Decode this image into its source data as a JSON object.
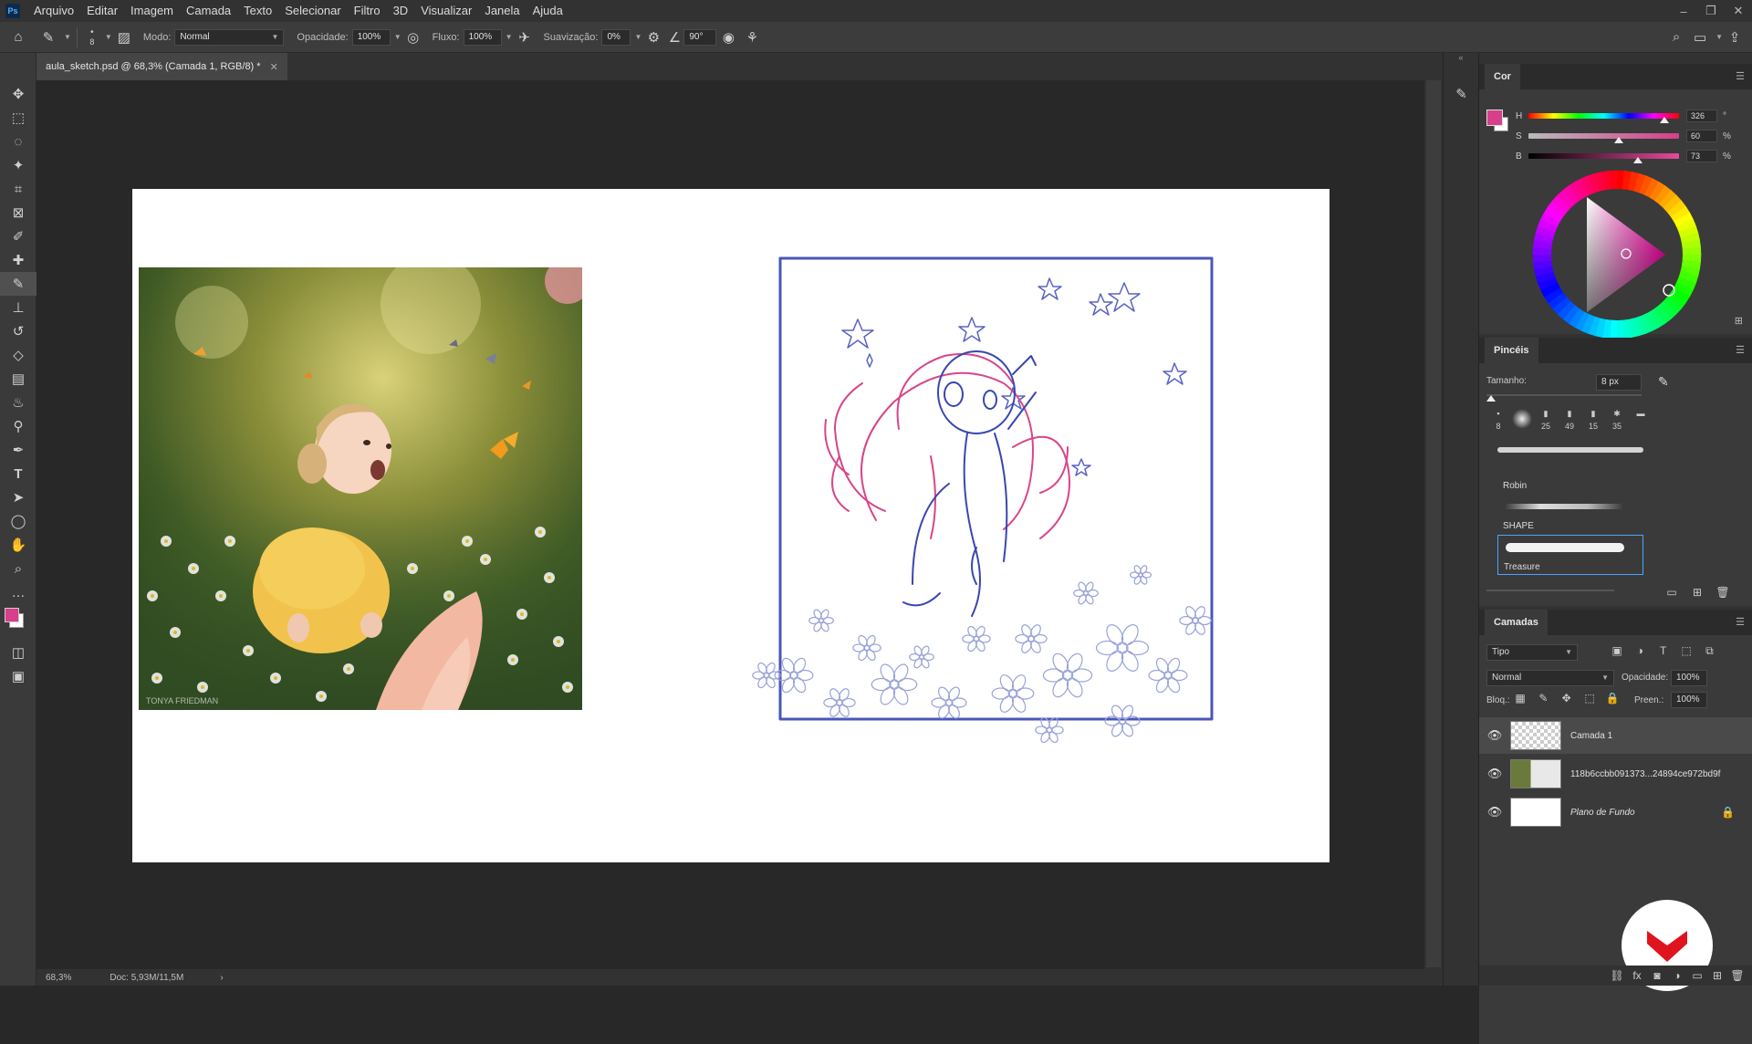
{
  "app": {
    "logo": "Ps"
  },
  "menu": [
    "Arquivo",
    "Editar",
    "Imagem",
    "Camada",
    "Texto",
    "Selecionar",
    "Filtro",
    "3D",
    "Visualizar",
    "Janela",
    "Ajuda"
  ],
  "window_controls": {
    "minimize": "–",
    "restore": "❐",
    "close": "✕"
  },
  "options": {
    "brush_size": "8",
    "mode_label": "Modo:",
    "mode_value": "Normal",
    "opacity_label": "Opacidade:",
    "opacity_value": "100%",
    "flow_label": "Fluxo:",
    "flow_value": "100%",
    "smoothing_label": "Suavização:",
    "smoothing_value": "0%",
    "angle_value": "90°"
  },
  "document": {
    "tab_title": "aula_sketch.psd @ 68,3% (Camada 1, RGB/8) *",
    "photo_watermark": "TONYA FRIEDMAN"
  },
  "status": {
    "zoom": "68,3%",
    "doc": "Doc: 5,93M/11,5M",
    "arrow": "›"
  },
  "color_panel": {
    "title": "Cor",
    "h_label": "H",
    "h_value": "326",
    "h_unit": "°",
    "s_label": "S",
    "s_value": "60",
    "s_unit": "%",
    "b_label": "B",
    "b_value": "73",
    "b_unit": "%",
    "foreground": "#d63f8b",
    "background": "#ffffff",
    "levels": {
      "h": 0.906,
      "s": 0.6,
      "b": 0.73
    }
  },
  "brushes_panel": {
    "title": "Pincéis",
    "size_label": "Tamanho:",
    "size_value": "8 px",
    "tips": [
      "8",
      "",
      "25",
      "49",
      "15",
      "35"
    ],
    "brushes": [
      "Robin",
      "SHAPE",
      "Treasure"
    ]
  },
  "layers_panel": {
    "title": "Camadas",
    "filter": "Tipo",
    "blend": "Normal",
    "opacity_label": "Opacidade:",
    "opacity_value": "100%",
    "lock_label": "Bloq.:",
    "fill_label": "Preen.:",
    "fill_value": "100%",
    "layers": [
      {
        "name": "Camada 1",
        "selected": true
      },
      {
        "name": "118b6ccbb091373...24894ce972bd9f",
        "selected": false
      },
      {
        "name": "Plano de Fundo",
        "selected": false
      }
    ]
  }
}
